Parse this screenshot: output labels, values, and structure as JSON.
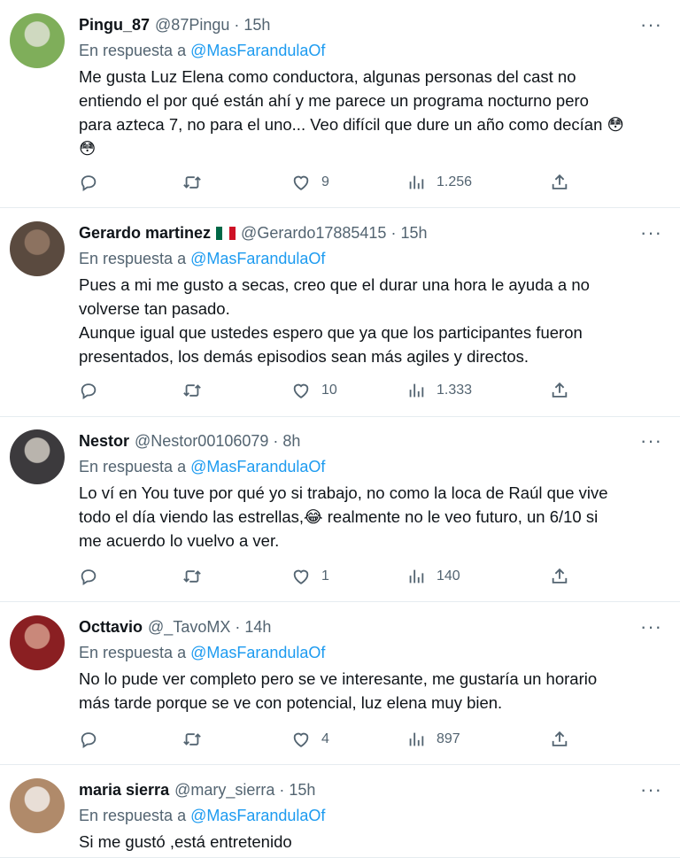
{
  "reply_prefix": "En respuesta a",
  "tweets": [
    {
      "name": "Pingu_87",
      "handle": "@87Pingu",
      "time": "15h",
      "reply_to": "@MasFarandulaOf",
      "text_lines": [
        "Me gusta Luz Elena como conductora, algunas personas del cast no",
        "entiendo el por qué están ahí y me parece un programa nocturno pero",
        "para azteca 7, no para el uno... Veo difícil que dure un año como decían 😳",
        "😳"
      ],
      "replies": "",
      "retweets": "",
      "likes": "9",
      "views": "1.256",
      "avatar_colors": [
        "#7fae5a",
        "#cfd9c0"
      ]
    },
    {
      "name": "Gerardo martinez",
      "flag": true,
      "handle": "@Gerardo17885415",
      "time": "15h",
      "reply_to": "@MasFarandulaOf",
      "text_lines": [
        "Pues a mi me gusto a secas, creo que el durar una hora le ayuda a no",
        "volverse tan pasado.",
        "Aunque igual que ustedes espero que ya que los participantes fueron",
        "presentados, los demás episodios sean más agiles y directos."
      ],
      "replies": "",
      "retweets": "",
      "likes": "10",
      "views": "1.333",
      "avatar_colors": [
        "#5a4a3f",
        "#8c7260"
      ]
    },
    {
      "name": "Nestor",
      "handle": "@Nestor00106079",
      "time": "8h",
      "reply_to": "@MasFarandulaOf",
      "text_lines": [
        "Lo ví en You tuve por qué yo si trabajo, no como la loca de Raúl que vive",
        "todo el día viendo las estrellas,😂 realmente no le veo futuro, un 6/10 si",
        "me acuerdo lo vuelvo a ver."
      ],
      "replies": "",
      "retweets": "",
      "likes": "1",
      "views": "140",
      "avatar_colors": [
        "#3c3a3d",
        "#b9b4ad"
      ]
    },
    {
      "name": "Octtavio",
      "handle": "@_TavoMX",
      "time": "14h",
      "reply_to": "@MasFarandulaOf",
      "text_lines": [
        "No lo pude ver completo pero se ve interesante, me gustaría un horario",
        "más tarde porque se ve con potencial, luz elena muy bien."
      ],
      "replies": "",
      "retweets": "",
      "likes": "4",
      "views": "897",
      "avatar_colors": [
        "#8a1f22",
        "#c9887a"
      ]
    },
    {
      "name": "maria sierra",
      "handle": "@mary_sierra",
      "time": "15h",
      "reply_to": "@MasFarandulaOf",
      "text_lines": [
        "Si me gustó ,está entretenido"
      ],
      "replies": "",
      "retweets": "",
      "likes": "",
      "views": "",
      "avatar_colors": [
        "#b08a6a",
        "#e8ded6"
      ]
    }
  ]
}
